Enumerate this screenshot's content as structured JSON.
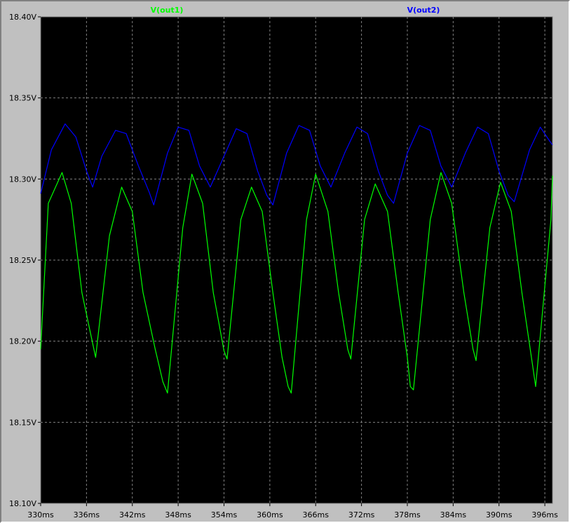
{
  "chart_data": {
    "type": "line",
    "x": {
      "unit": "ms",
      "range": [
        330,
        397
      ],
      "ticks": [
        330,
        336,
        342,
        348,
        354,
        360,
        366,
        372,
        378,
        384,
        390,
        396
      ],
      "tick_labels": [
        "330ms",
        "336ms",
        "342ms",
        "348ms",
        "354ms",
        "360ms",
        "366ms",
        "372ms",
        "378ms",
        "384ms",
        "390ms",
        "396ms"
      ]
    },
    "y": {
      "unit": "V",
      "range": [
        18.1,
        18.4
      ],
      "ticks": [
        18.1,
        18.15,
        18.2,
        18.25,
        18.3,
        18.35,
        18.4
      ],
      "tick_labels": [
        "18.10V",
        "18.15V",
        "18.20V",
        "18.25V",
        "18.30V",
        "18.35V",
        "18.40V"
      ]
    },
    "grid": true,
    "background": "#000000",
    "series": [
      {
        "name": "V(out1)",
        "color": "#00ff00",
        "points": [
          [
            330.0,
            18.195
          ],
          [
            331.0,
            18.285
          ],
          [
            332.8,
            18.304
          ],
          [
            334.0,
            18.285
          ],
          [
            335.4,
            18.23
          ],
          [
            337.2,
            18.19
          ],
          [
            339.0,
            18.265
          ],
          [
            340.6,
            18.295
          ],
          [
            342.0,
            18.28
          ],
          [
            343.4,
            18.23
          ],
          [
            345.0,
            18.195
          ],
          [
            346.0,
            18.175
          ],
          [
            346.6,
            18.168
          ],
          [
            348.6,
            18.27
          ],
          [
            349.8,
            18.303
          ],
          [
            351.2,
            18.285
          ],
          [
            352.6,
            18.23
          ],
          [
            354.0,
            18.194
          ],
          [
            354.4,
            18.189
          ],
          [
            356.2,
            18.275
          ],
          [
            357.6,
            18.295
          ],
          [
            359.0,
            18.28
          ],
          [
            360.4,
            18.23
          ],
          [
            361.6,
            18.19
          ],
          [
            362.4,
            18.172
          ],
          [
            362.8,
            18.168
          ],
          [
            364.8,
            18.275
          ],
          [
            366.0,
            18.303
          ],
          [
            367.6,
            18.28
          ],
          [
            369.0,
            18.23
          ],
          [
            370.2,
            18.195
          ],
          [
            370.6,
            18.189
          ],
          [
            372.4,
            18.275
          ],
          [
            373.8,
            18.297
          ],
          [
            375.4,
            18.28
          ],
          [
            376.8,
            18.23
          ],
          [
            378.0,
            18.19
          ],
          [
            378.4,
            18.172
          ],
          [
            378.8,
            18.17
          ],
          [
            381.0,
            18.275
          ],
          [
            382.4,
            18.304
          ],
          [
            383.8,
            18.285
          ],
          [
            385.4,
            18.23
          ],
          [
            386.6,
            18.195
          ],
          [
            387.0,
            18.188
          ],
          [
            388.8,
            18.27
          ],
          [
            390.2,
            18.298
          ],
          [
            391.6,
            18.28
          ],
          [
            393.0,
            18.23
          ],
          [
            394.4,
            18.185
          ],
          [
            394.8,
            18.172
          ],
          [
            396.8,
            18.275
          ],
          [
            397.0,
            18.302
          ]
        ]
      },
      {
        "name": "V(out2)",
        "color": "#0000ff",
        "points": [
          [
            330.0,
            18.291
          ],
          [
            331.4,
            18.318
          ],
          [
            333.2,
            18.334
          ],
          [
            334.6,
            18.326
          ],
          [
            336.0,
            18.305
          ],
          [
            336.8,
            18.295
          ],
          [
            338.0,
            18.314
          ],
          [
            339.8,
            18.33
          ],
          [
            341.2,
            18.328
          ],
          [
            342.8,
            18.308
          ],
          [
            344.2,
            18.292
          ],
          [
            344.8,
            18.284
          ],
          [
            346.6,
            18.316
          ],
          [
            348.0,
            18.332
          ],
          [
            349.4,
            18.33
          ],
          [
            350.8,
            18.308
          ],
          [
            352.2,
            18.295
          ],
          [
            354.0,
            18.314
          ],
          [
            355.6,
            18.331
          ],
          [
            357.0,
            18.328
          ],
          [
            358.4,
            18.305
          ],
          [
            359.6,
            18.29
          ],
          [
            360.4,
            18.284
          ],
          [
            362.2,
            18.316
          ],
          [
            363.8,
            18.333
          ],
          [
            365.2,
            18.33
          ],
          [
            366.6,
            18.308
          ],
          [
            368.0,
            18.295
          ],
          [
            369.8,
            18.316
          ],
          [
            371.4,
            18.332
          ],
          [
            372.8,
            18.328
          ],
          [
            374.2,
            18.305
          ],
          [
            375.4,
            18.29
          ],
          [
            376.2,
            18.285
          ],
          [
            378.0,
            18.316
          ],
          [
            379.6,
            18.333
          ],
          [
            381.0,
            18.33
          ],
          [
            382.4,
            18.308
          ],
          [
            383.8,
            18.295
          ],
          [
            385.6,
            18.316
          ],
          [
            387.2,
            18.332
          ],
          [
            388.6,
            18.328
          ],
          [
            390.0,
            18.305
          ],
          [
            391.2,
            18.29
          ],
          [
            392.0,
            18.286
          ],
          [
            394.0,
            18.318
          ],
          [
            395.4,
            18.332
          ],
          [
            396.4,
            18.325
          ],
          [
            397.0,
            18.321
          ]
        ]
      }
    ]
  }
}
